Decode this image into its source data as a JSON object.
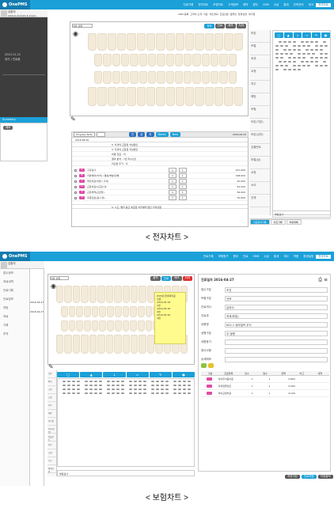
{
  "brand": "OnePMS",
  "menu1": [
    "진료기록",
    "전자차트",
    "보험차트",
    "고객정보",
    "예약",
    "원무",
    "CRM",
    "수납",
    "통계",
    "인력관리",
    "재고",
    "전자차트"
  ],
  "menu2": [
    "진료기록",
    "보험청구",
    "원무",
    "진료",
    "CRM",
    "수납",
    "통계",
    "재고",
    "약품",
    "환경설정",
    "전자차트"
  ],
  "patient": {
    "name": "김환자",
    "info": "2005-01-01(여/16) 외 1인(21)"
  },
  "chart1": {
    "tabs": [
      "전자",
      "진료",
      "메모",
      "치과"
    ],
    "leftrows": [
      "2013.11.21",
      "대기",
      "진료중"
    ],
    "summary": "Summary",
    "actions": [
      "CRM 등록",
      "고객이 소개",
      "자료",
      "차트계획",
      "진료인원",
      "템플릿",
      "환경설정",
      "대기열"
    ],
    "progress": "Progress Note",
    "buttons": [
      "진",
      "상",
      "치",
      "Notes",
      "New"
    ],
    "date": "2016.08.26",
    "diag": "S. 치과의 교합된 치상원인",
    "notes": [
      "S. 지과의 교합된 지상원인",
      "비염 진료 - 치",
      "결과 분석 - 7번 지수(안)",
      "지선정 추가 - 치"
    ],
    "rxrows": [
      {
        "code": "A",
        "name": "구강검사",
        "v1": "1",
        "v2": "1",
        "amt": "227,000"
      },
      {
        "code": "B",
        "name": "치면세마(치석) / 통상/부분/전체",
        "v1": "1",
        "v2": "1",
        "amt": "198,000"
      },
      {
        "code": "C",
        "name": "레진치료(치면 / 구치)",
        "v1": "1",
        "v2": "1",
        "amt": "40,000"
      },
      {
        "code": "D",
        "name": "근관치료(1근관) 외",
        "v1": "1",
        "v2": "1",
        "amt": "81,000"
      },
      {
        "code": "E",
        "name": "근관세척(근관당)",
        "v1": "1",
        "v2": "1",
        "amt": "36,000"
      },
      {
        "code": "F",
        "name": "주문진료(표시 외)",
        "v1": "1",
        "v2": "1",
        "amt": "35,000"
      }
    ],
    "diag2": "S. 시도, 벌지 둥근 새로운 치주병적 원인 지치상원",
    "cats": [
      "보존",
      "보철",
      "외과",
      "교정",
      "치주",
      "예방",
      "보험",
      "보존(기본)",
      "보존(심미)",
      "임플란트",
      "보철(상)",
      "교정",
      "소아",
      "전체"
    ],
    "footerbtns": [
      "치료회차기록",
      "차트기록",
      "처방목록"
    ],
    "memo": "부등검사"
  },
  "chart2": {
    "leftitems": [
      "접수정보",
      "치료내역",
      "진료기록",
      "진료정보",
      "처방",
      "치료",
      "기록",
      "투약"
    ],
    "dates": [
      "2016.04.27",
      "2016.04.27"
    ],
    "topbtns": [
      "출력",
      "진료",
      "메모",
      "치과"
    ],
    "title": "진료일자 2016-04-27",
    "fields": [
      {
        "label": "접수구분",
        "value": "초진"
      },
      {
        "label": "보험구분",
        "value": "건보"
      },
      {
        "label": "진료의사",
        "value": "김의사"
      },
      {
        "label": "진료과",
        "value": "치과(보존)"
      },
      {
        "label": "상병명",
        "value": "K02.1 상아질의 우식"
      },
      {
        "label": "상병구분",
        "value": "주 상병"
      },
      {
        "label": "내원동기",
        "value": ""
      },
      {
        "label": "특이사항",
        "value": ""
      },
      {
        "label": "상세메모",
        "value": ""
      }
    ],
    "rxhead": [
      "구분",
      "진료항목",
      "횟수",
      "일수",
      "금액",
      "비고",
      "내역"
    ],
    "rx": [
      {
        "name": "치아우식증치료",
        "qty": "1",
        "days": "1",
        "amt": "5,860"
      },
      {
        "name": "치과임플란트",
        "qty": "1",
        "days": "1",
        "amt": "5,560"
      },
      {
        "name": "치아교정치료",
        "qty": "1",
        "days": "1",
        "amt": "4,100"
      }
    ],
    "note": "#15번 환세대치료\n진료\n2016.05.18\n1번\n2016.05.18\n2번\n2016.05.26\n3번",
    "cats": [
      "보존",
      "외과",
      "소아",
      "교정",
      "치주",
      "예방",
      "치보험",
      "치과(보존)",
      "임플란트",
      "치주",
      "교정",
      "기타",
      "외래지정"
    ],
    "memo": "부등검사",
    "btns": [
      "처방저장",
      "진료저장",
      "처방출력"
    ]
  },
  "captions": {
    "top": "< 전자차트 >",
    "bottom": "< 보험차트 >"
  }
}
